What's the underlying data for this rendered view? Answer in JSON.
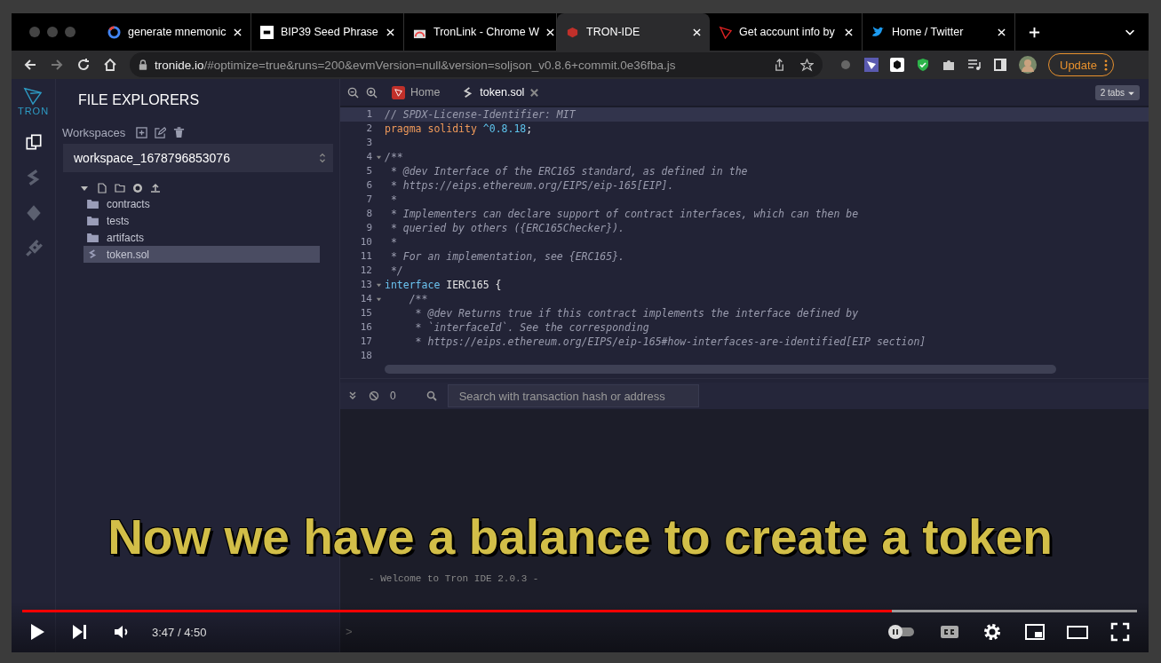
{
  "browser_tabs": [
    {
      "title": "generate mnemonic",
      "selected": false
    },
    {
      "title": "BIP39 Seed Phrase",
      "selected": false
    },
    {
      "title": "TronLink - Chrome W",
      "selected": false
    },
    {
      "title": "TRON-IDE",
      "selected": true
    },
    {
      "title": "Get account info by",
      "selected": false
    },
    {
      "title": "Home / Twitter",
      "selected": false
    }
  ],
  "address_bar": {
    "host": "tronide.io",
    "path": "/#optimize=true&runs=200&evmVersion=null&version=soljson_v0.8.6+commit.0e36fba.js"
  },
  "update_button": "Update",
  "logo_text": "TRON",
  "file_explorer": {
    "title": "FILE EXPLORERS",
    "workspaces_label": "Workspaces",
    "workspace": "workspace_1678796853076",
    "items": [
      {
        "name": "contracts",
        "kind": "folder",
        "selected": false
      },
      {
        "name": "tests",
        "kind": "folder",
        "selected": false
      },
      {
        "name": "artifacts",
        "kind": "folder",
        "selected": false
      },
      {
        "name": "token.sol",
        "kind": "file",
        "selected": true
      }
    ]
  },
  "editor_tabs": [
    {
      "title": "Home",
      "selected": false,
      "kind": "home"
    },
    {
      "title": "token.sol",
      "selected": true,
      "kind": "file"
    }
  ],
  "tabs_menu": "2 tabs",
  "code": [
    {
      "n": "1",
      "fold": false,
      "current": true,
      "segs": [
        {
          "text": "// SPDX-License-Identifier: MIT",
          "kind": "comment"
        }
      ]
    },
    {
      "n": "2",
      "fold": false,
      "current": false,
      "segs": [
        {
          "text": "pragma solidity ",
          "kind": "keyword"
        },
        {
          "text": "^0.8.18",
          "kind": "number"
        },
        {
          "text": ";",
          "kind": "plain"
        }
      ]
    },
    {
      "n": "3",
      "fold": false,
      "current": false
    },
    {
      "n": "4",
      "fold": true,
      "current": false,
      "segs": [
        {
          "text": "/**",
          "kind": "comment"
        }
      ]
    },
    {
      "n": "5",
      "fold": false,
      "current": false,
      "segs": [
        {
          "text": " * @dev Interface of the ERC165 standard, as defined in the",
          "kind": "comment"
        }
      ]
    },
    {
      "n": "6",
      "fold": false,
      "current": false,
      "segs": [
        {
          "text": " * https://eips.ethereum.org/EIPS/eip-165[EIP].",
          "kind": "comment"
        }
      ]
    },
    {
      "n": "7",
      "fold": false,
      "current": false,
      "segs": [
        {
          "text": " *",
          "kind": "comment"
        }
      ]
    },
    {
      "n": "8",
      "fold": false,
      "current": false,
      "segs": [
        {
          "text": " * Implementers can declare support of contract interfaces, which can then be",
          "kind": "comment"
        }
      ]
    },
    {
      "n": "9",
      "fold": false,
      "current": false,
      "segs": [
        {
          "text": " * queried by others ({ERC165Checker}).",
          "kind": "comment"
        }
      ]
    },
    {
      "n": "10",
      "fold": false,
      "current": false,
      "segs": [
        {
          "text": " *",
          "kind": "comment"
        }
      ]
    },
    {
      "n": "11",
      "fold": false,
      "current": false,
      "segs": [
        {
          "text": " * For an implementation, see {ERC165}.",
          "kind": "comment"
        }
      ]
    },
    {
      "n": "12",
      "fold": false,
      "current": false,
      "segs": [
        {
          "text": " */",
          "kind": "comment"
        }
      ]
    },
    {
      "n": "13",
      "fold": true,
      "current": false,
      "segs": [
        {
          "text": "interface",
          "kind": "type"
        },
        {
          "text": " IERC165 {",
          "kind": "plain"
        }
      ]
    },
    {
      "n": "14",
      "fold": true,
      "current": false,
      "segs": [
        {
          "text": "    /**",
          "kind": "comment"
        }
      ]
    },
    {
      "n": "15",
      "fold": false,
      "current": false,
      "segs": [
        {
          "text": "     * @dev Returns true if this contract implements the interface defined by",
          "kind": "comment"
        }
      ]
    },
    {
      "n": "16",
      "fold": false,
      "current": false,
      "segs": [
        {
          "text": "     * `interfaceId`. See the corresponding",
          "kind": "comment"
        }
      ]
    },
    {
      "n": "17",
      "fold": false,
      "current": false,
      "segs": [
        {
          "text": "     * https://eips.ethereum.org/EIPS/eip-165#how-interfaces-are-identified[EIP section]",
          "kind": "comment"
        }
      ]
    },
    {
      "n": "18",
      "fold": false,
      "current": false
    }
  ],
  "terminal": {
    "count": "0",
    "search_placeholder": "Search with transaction hash or address",
    "welcome": "- Welcome to Tron IDE 2.0.3 -",
    "prompt": ">"
  },
  "subtitle": "Now we have a balance to create a token",
  "player": {
    "level": 0.78,
    "time": "3:47 / 4:50"
  }
}
